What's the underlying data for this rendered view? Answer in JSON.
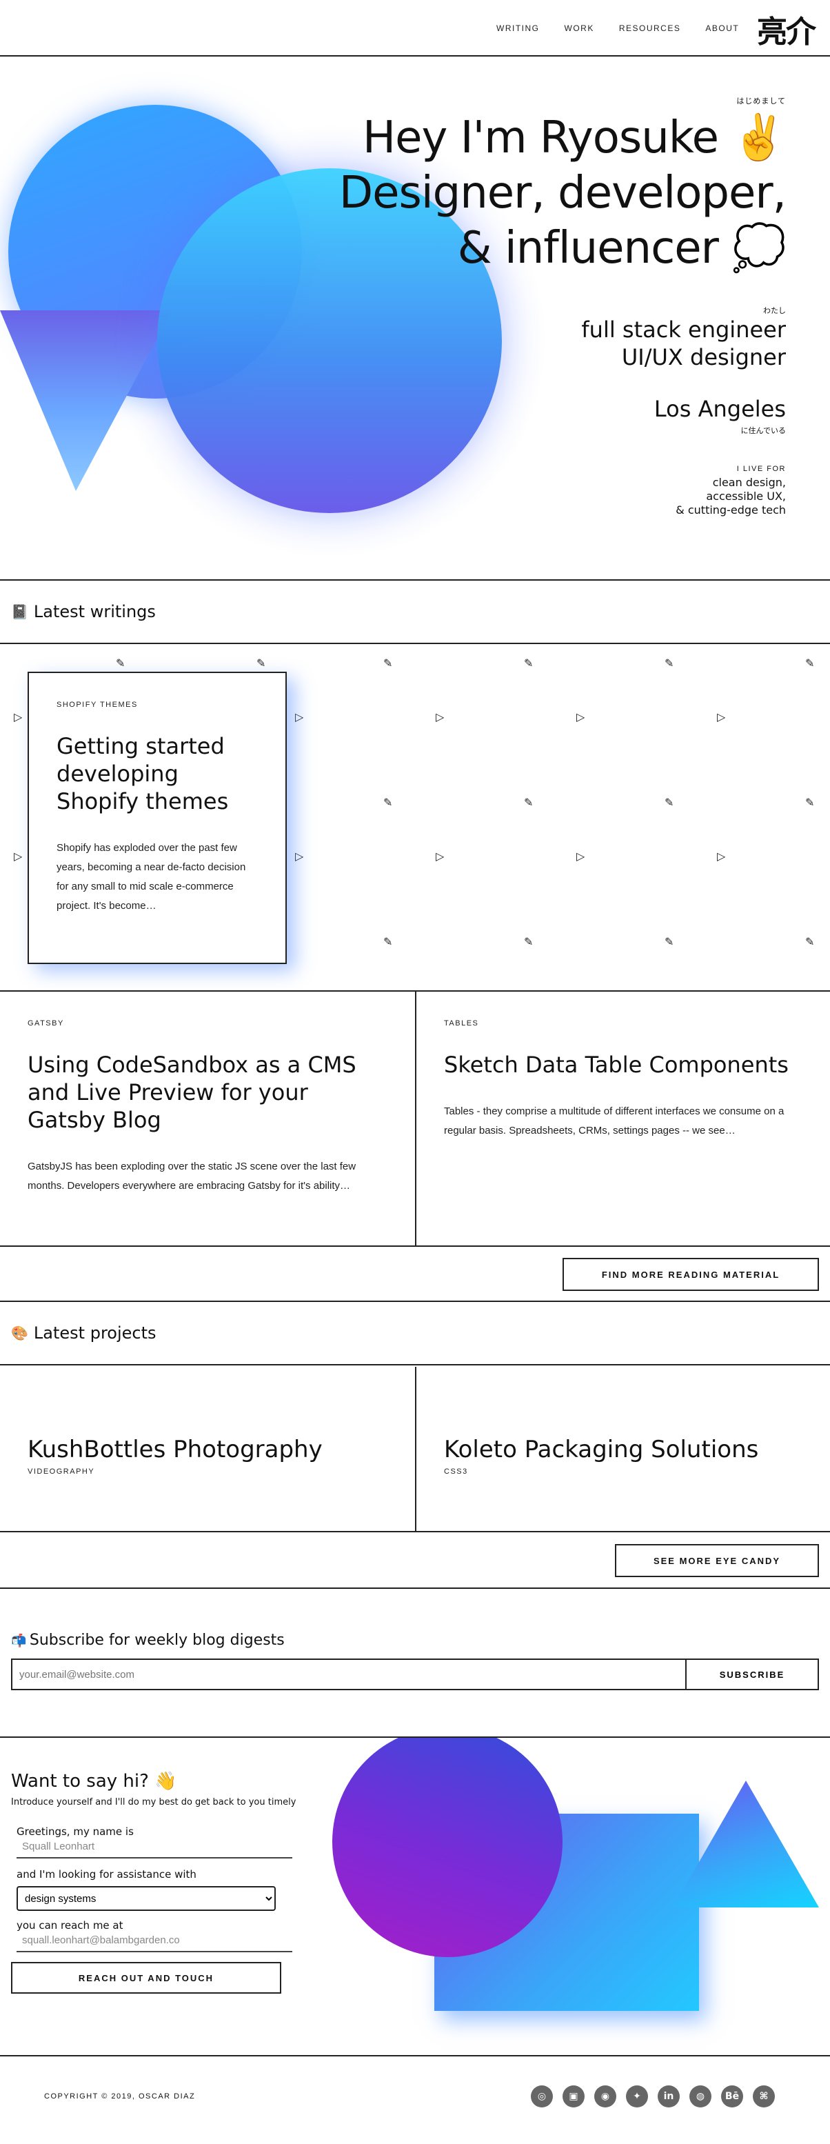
{
  "header": {
    "nav": [
      {
        "label": "WRITING"
      },
      {
        "label": "WORK"
      },
      {
        "label": "RESOURCES"
      },
      {
        "label": "ABOUT"
      }
    ],
    "logo": "亮介"
  },
  "hero": {
    "hajimemashite": "はじめまして",
    "title_line1": "Hey I'm Ryosuke ✌️",
    "title_line2": "Designer, developer,",
    "title_line3": "& influencer 💭",
    "watashi": "わたし",
    "role1": "full stack engineer",
    "role2": "UI/UX designer",
    "city": "Los Angeles",
    "live_in": "に住んでいる",
    "i_live_for": "I LIVE FOR",
    "live_for": [
      "clean design,",
      "accessible UX,",
      "& cutting-edge tech"
    ]
  },
  "writings": {
    "icon": "📓",
    "heading": "Latest writings",
    "featured": {
      "tag": "SHOPIFY THEMES",
      "title": "Getting started developing Shopify themes",
      "excerpt": "Shopify has exploded over the past few years, becoming a near de-facto decision for any small to mid scale e-commerce project. It's become…"
    },
    "posts": [
      {
        "tag": "GATSBY",
        "title": "Using CodeSandbox as a CMS and Live Preview for your Gatsby Blog",
        "excerpt": "GatsbyJS has been exploding over the static JS scene over the last few months. Developers everywhere are embracing Gatsby for it's ability…"
      },
      {
        "tag": "TABLES",
        "title": "Sketch Data Table Components",
        "excerpt": "Tables - they comprise a multitude of different interfaces we consume on a regular basis. Spreadsheets, CRMs, settings pages -- we see…"
      }
    ],
    "more_button": "FIND MORE READING MATERIAL"
  },
  "projects": {
    "icon": "🎨",
    "heading": "Latest projects",
    "items": [
      {
        "title": "KushBottles Photography",
        "tag": "VIDEOGRAPHY"
      },
      {
        "title": "Koleto Packaging Solutions",
        "tag": "CSS3"
      }
    ],
    "more_button": "SEE MORE EYE CANDY"
  },
  "subscribe": {
    "icon": "📬",
    "heading": "Subscribe for weekly blog digests",
    "placeholder": "your.email@website.com",
    "button": "SUBSCRIBE"
  },
  "contact": {
    "heading": "Want to say hi? 👋",
    "subheading": "Introduce yourself and I'll do my best do get back to you timely",
    "name_label": "Greetings, my name is",
    "name_placeholder": "Squall Leonhart",
    "assist_label": "and I'm looking for assistance with",
    "assist_value": "design systems",
    "reach_label": "you can reach me at",
    "email_placeholder": "squall.leonhart@balambgarden.co",
    "button": "REACH OUT AND TOUCH"
  },
  "footer": {
    "copyright": "COPYRIGHT © 2019, OSCAR DIAZ",
    "socials": [
      {
        "name": "codepen-icon",
        "glyph": "◎"
      },
      {
        "name": "twitch-icon",
        "glyph": "▣"
      },
      {
        "name": "instagram-icon",
        "glyph": "◉"
      },
      {
        "name": "twitter-icon",
        "glyph": "✦"
      },
      {
        "name": "linkedin-icon",
        "glyph": "in"
      },
      {
        "name": "dribbble-icon",
        "glyph": "◍"
      },
      {
        "name": "behance-icon",
        "glyph": "Bē"
      },
      {
        "name": "github-icon",
        "glyph": "⌘"
      }
    ]
  }
}
